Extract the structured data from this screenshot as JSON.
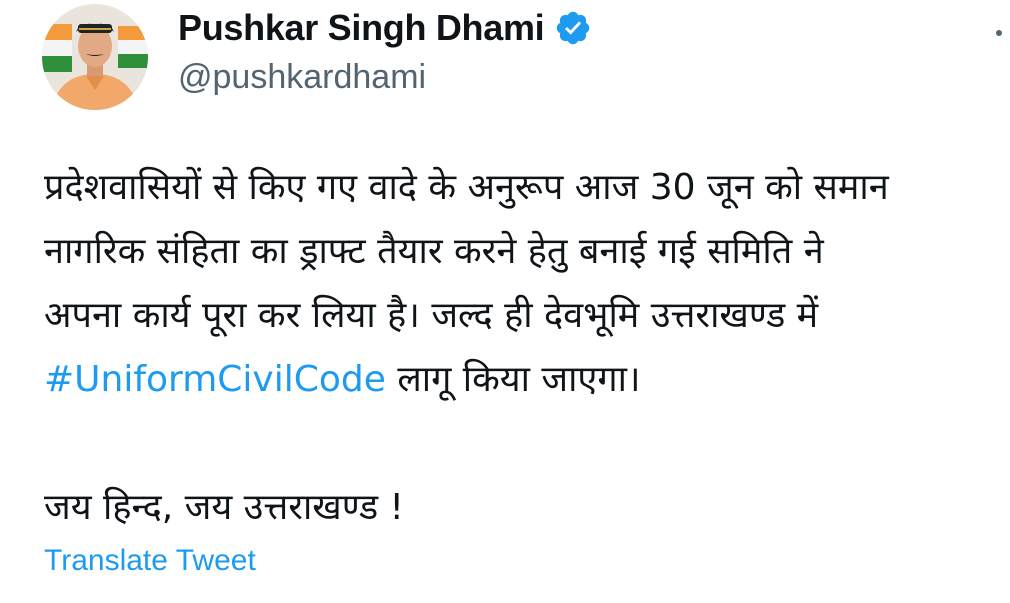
{
  "author": {
    "display_name": "Pushkar Singh Dhami",
    "handle": "@pushkardhami",
    "verified_icon": "verified-badge-icon",
    "verified_color": "#1d9bf0"
  },
  "tweet": {
    "lines": {
      "l1": "प्रदेशवासियों से किए गए वादे के अनुरूप आज 30 जून को समान",
      "l2": "नागरिक संहिता का ड्राफ्ट तैयार करने हेतु बनाई गई समिति ने",
      "l3": "अपना कार्य पूरा कर लिया है। जल्द ही देवभूमि उत्तराखण्ड में",
      "hashtag": "#UniformCivilCode",
      "l4_rest": " लागू किया जाएगा।",
      "l5": "जय हिन्द, जय उत्तराखण्ड !"
    },
    "translate_label": "Translate Tweet"
  },
  "colors": {
    "text": "#0f1419",
    "secondary": "#536471",
    "link": "#1d9bf0"
  },
  "icons": {
    "more": "more-options-icon"
  }
}
